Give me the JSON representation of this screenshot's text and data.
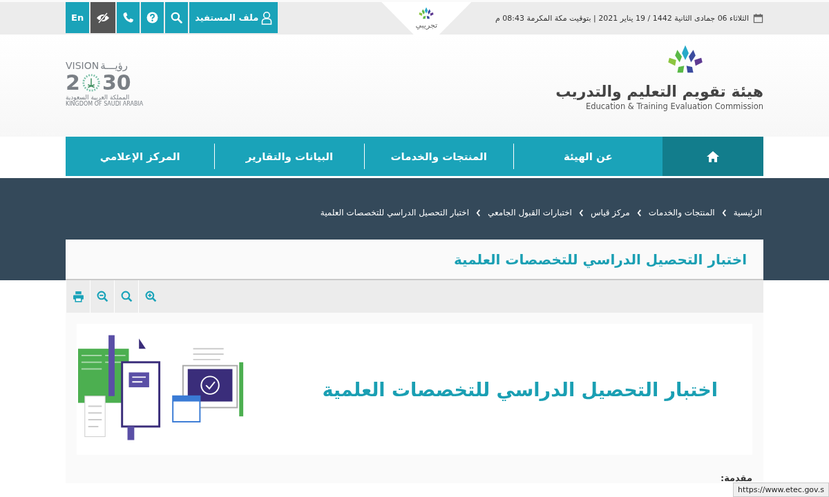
{
  "top_bar": {
    "date_text": "الثلاثاء 06 جمادى الثانية 1442 / 19 يناير 2021 | بتوقيت مكة المكرمة 08:43 م",
    "beta_label": "تجريبي",
    "buttons": [
      {
        "kind": "profile",
        "label": "ملف المستفيد"
      },
      {
        "kind": "search"
      },
      {
        "kind": "help"
      },
      {
        "kind": "phone"
      },
      {
        "kind": "contrast"
      },
      {
        "kind": "language",
        "label": "En"
      }
    ]
  },
  "header": {
    "org_name_ar": "هيئة تقويم التعليم والتدريب",
    "org_name_en": "Education & Training Evaluation Commission",
    "vision": {
      "word_en": "VISION",
      "word_ar": "رؤيـــة",
      "year_start": "2",
      "year_end": "30",
      "country_ar": "المملكة العربية السعودية",
      "country_en": "KINGDOM OF SAUDI ARABIA"
    }
  },
  "nav": [
    {
      "kind": "home",
      "selected": true
    },
    {
      "kind": "link",
      "label": "عن الهيئة",
      "selected": false
    },
    {
      "kind": "link",
      "label": "المنتجات والخدمات",
      "selected": false
    },
    {
      "kind": "link",
      "label": "البيانات والتقارير",
      "selected": false
    },
    {
      "kind": "link",
      "label": "المركز الإعلامي",
      "selected": false
    }
  ],
  "breadcrumb": [
    "الرئيسية",
    "المنتجات والخدمات",
    "مركز قياس",
    "اختبارات القبول الجامعي",
    "اختبار التحصيل الدراسي للتخصصات العلمية"
  ],
  "page_title": "اختبار التحصيل الدراسي للتخصصات العلمية",
  "tools": [
    {
      "kind": "zoom-in"
    },
    {
      "kind": "zoom-reset"
    },
    {
      "kind": "zoom-out"
    },
    {
      "kind": "print"
    }
  ],
  "banner": {
    "title": "اختبار التحصيل الدراسي للتخصصات العلمية"
  },
  "section_heading": "مقدمة:",
  "status_url": "https://www.etec.gov.s"
}
